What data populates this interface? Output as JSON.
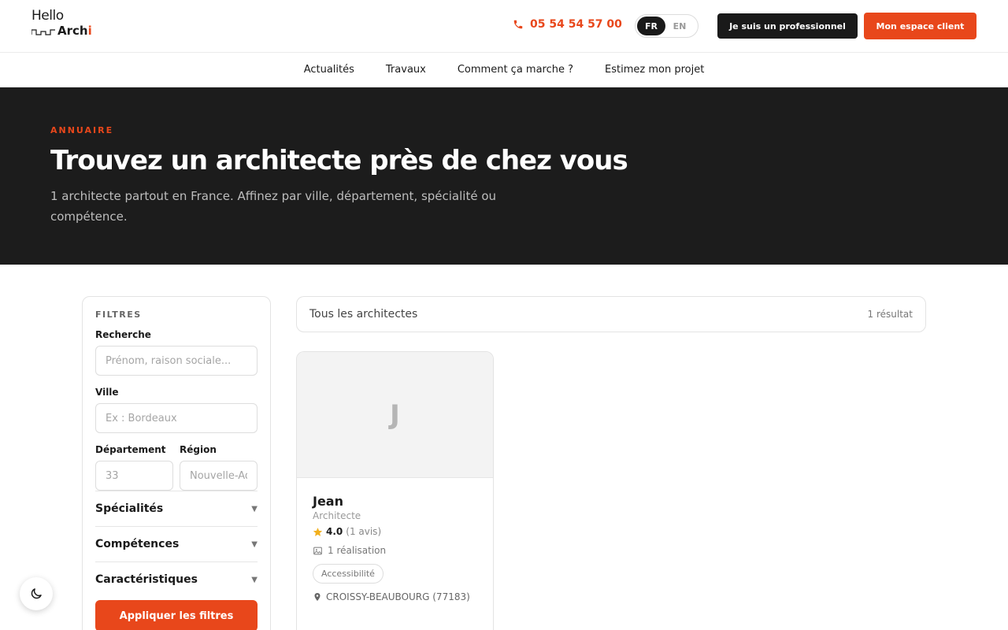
{
  "header": {
    "logo_hello": "Hello",
    "logo_archi_prefix": "Arch",
    "logo_archi_suffix": "i",
    "phone": "05 54 54 57 00",
    "lang_fr": "FR",
    "lang_en": "EN",
    "pro_button": "Je suis un professionnel",
    "client_button": "Mon espace client"
  },
  "nav": {
    "items": [
      "Actualités",
      "Travaux",
      "Comment ça marche ?",
      "Estimez mon projet"
    ]
  },
  "hero": {
    "eyebrow": "ANNUAIRE",
    "title": "Trouvez un architecte près de chez vous",
    "subtitle": "1 architecte partout en France. Affinez par ville, département, spécialité ou compétence."
  },
  "filters": {
    "heading": "FILTRES",
    "search_label": "Recherche",
    "search_placeholder": "Prénom, raison sociale...",
    "city_label": "Ville",
    "city_placeholder": "Ex : Bordeaux",
    "department_label": "Département",
    "department_placeholder": "33",
    "region_label": "Région",
    "region_placeholder": "Nouvelle-Aquitaine",
    "sections": [
      "Spécialités",
      "Compétences",
      "Caractéristiques"
    ],
    "apply_button": "Appliquer les filtres"
  },
  "results": {
    "title": "Tous les architectes",
    "count": "1 résultat",
    "cards": [
      {
        "initial": "J",
        "name": "Jean",
        "role": "Architecte",
        "rating": "4.0",
        "reviews": "(1 avis)",
        "realisations": "1 réalisation",
        "tag": "Accessibilité",
        "location": "CROISSY-BEAUBOURG (77183)"
      }
    ]
  },
  "colors": {
    "accent": "#e8471b",
    "dark": "#1c1c1c",
    "star": "#f2b01e"
  },
  "icons": {
    "phone": "phone-icon",
    "star": "star-icon",
    "image": "image-icon",
    "location": "map-pin-icon",
    "caret": "chevron-down-icon",
    "theme": "moon-icon"
  }
}
